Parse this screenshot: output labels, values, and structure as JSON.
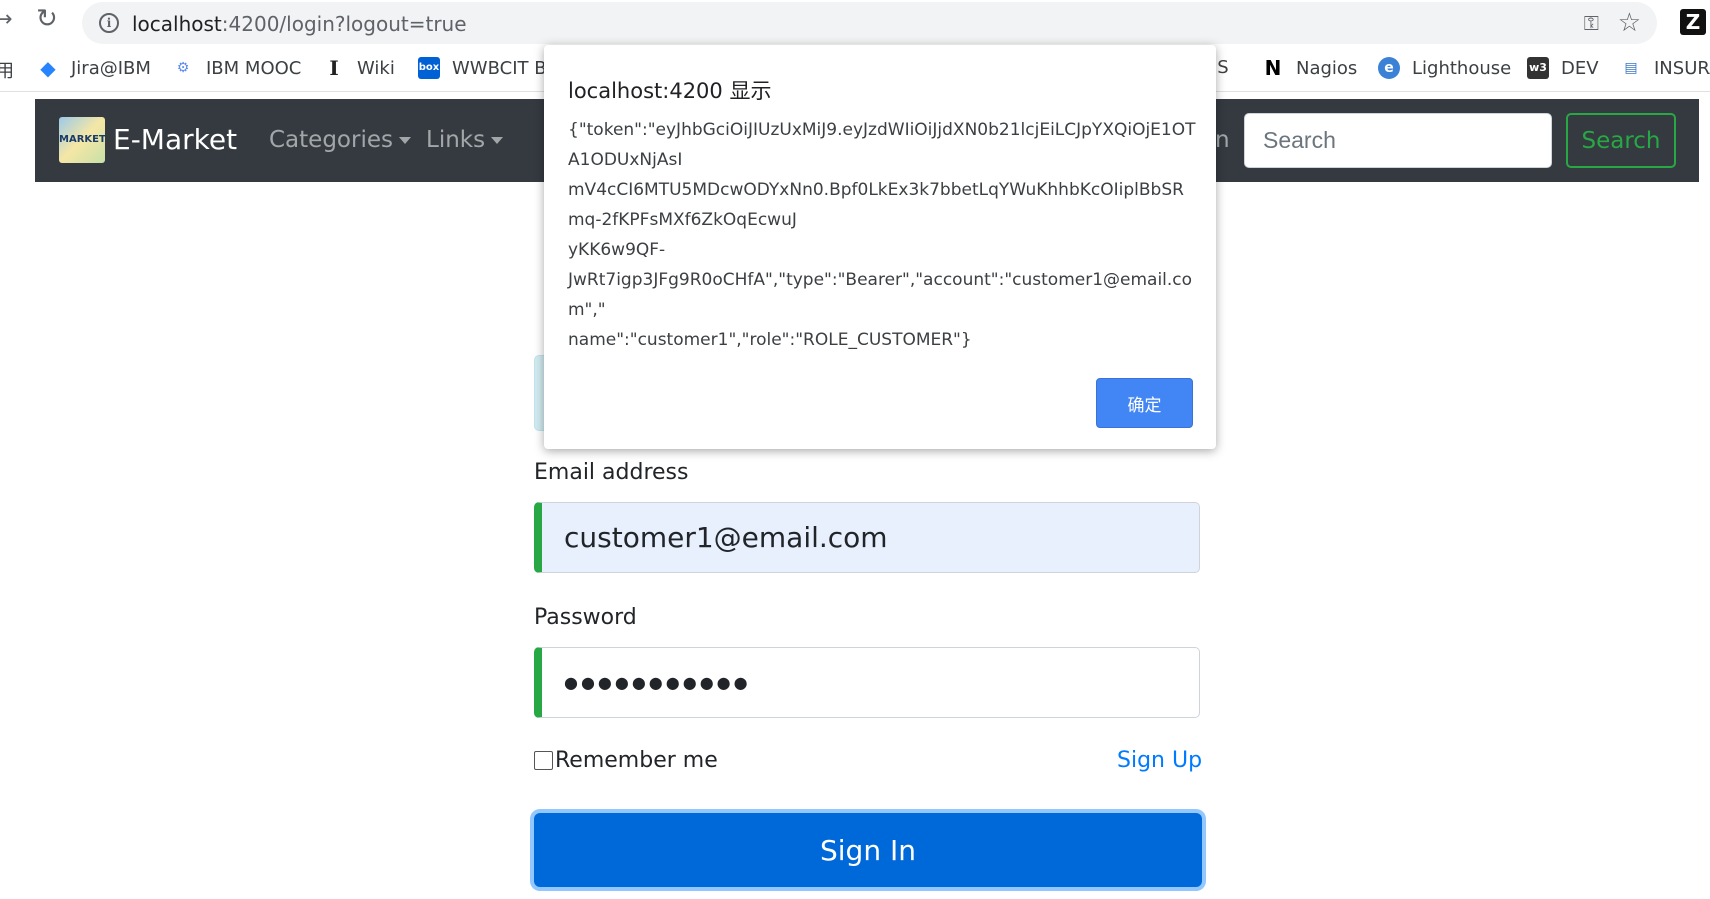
{
  "browser": {
    "url_host": "localhost",
    "url_rest": ":4200/login?logout=true",
    "extension_letter": "Z"
  },
  "bookmarks": [
    {
      "label": "用",
      "icon": ""
    },
    {
      "label": "Jira@IBM",
      "icon": "◆"
    },
    {
      "label": "IBM MOOC",
      "icon": "⚙"
    },
    {
      "label": "Wiki",
      "icon": "I"
    },
    {
      "label": "WWBCIT Bo",
      "icon": "box"
    },
    {
      "label": "JS",
      "icon": ""
    },
    {
      "label": "Nagios",
      "icon": "N"
    },
    {
      "label": "Lighthouse",
      "icon": "e"
    },
    {
      "label": "DEV",
      "icon": "w3"
    },
    {
      "label": "INSURA",
      "icon": "▤"
    }
  ],
  "navbar": {
    "brand": "E-Market",
    "logo_text": "MARKET",
    "categories": "Categories",
    "links": "Links",
    "partial_link": "n",
    "search_placeholder": "Search",
    "search_button": "Search"
  },
  "login": {
    "email_label": "Email address",
    "email_value": "customer1@email.com",
    "password_label": "Password",
    "password_value": "●●●●●●●●●●●",
    "remember_label": "Remember me",
    "signup_link": "Sign Up",
    "signin_button": "Sign In"
  },
  "dialog": {
    "title": "localhost:4200 显示",
    "message": "{\"token\":\"eyJhbGciOiJIUzUxMiJ9.eyJzdWIiOiJjdXN0b21lcjEiLCJpYXQiOjE1OTA1ODUxNjAsI\nmV4cCI6MTU5MDcwODYxNn0.Bpf0LkEx3k7bbetLqYWuKhhbKcOIiplBbSRmq-2fKPFsMXf6ZkOqEcwuJ\nyKK6w9QF-\nJwRt7igp3JFg9R0oCHfA\",\"type\":\"Bearer\",\"account\":\"customer1@email.com\",\"\nname\":\"customer1\",\"role\":\"ROLE_CUSTOMER\"}",
    "ok_button": "确定"
  },
  "colors": {
    "navbar_bg": "#343a40",
    "valid_green": "#28a745",
    "primary_blue": "#0069d9",
    "dialog_button": "#4285f4"
  }
}
